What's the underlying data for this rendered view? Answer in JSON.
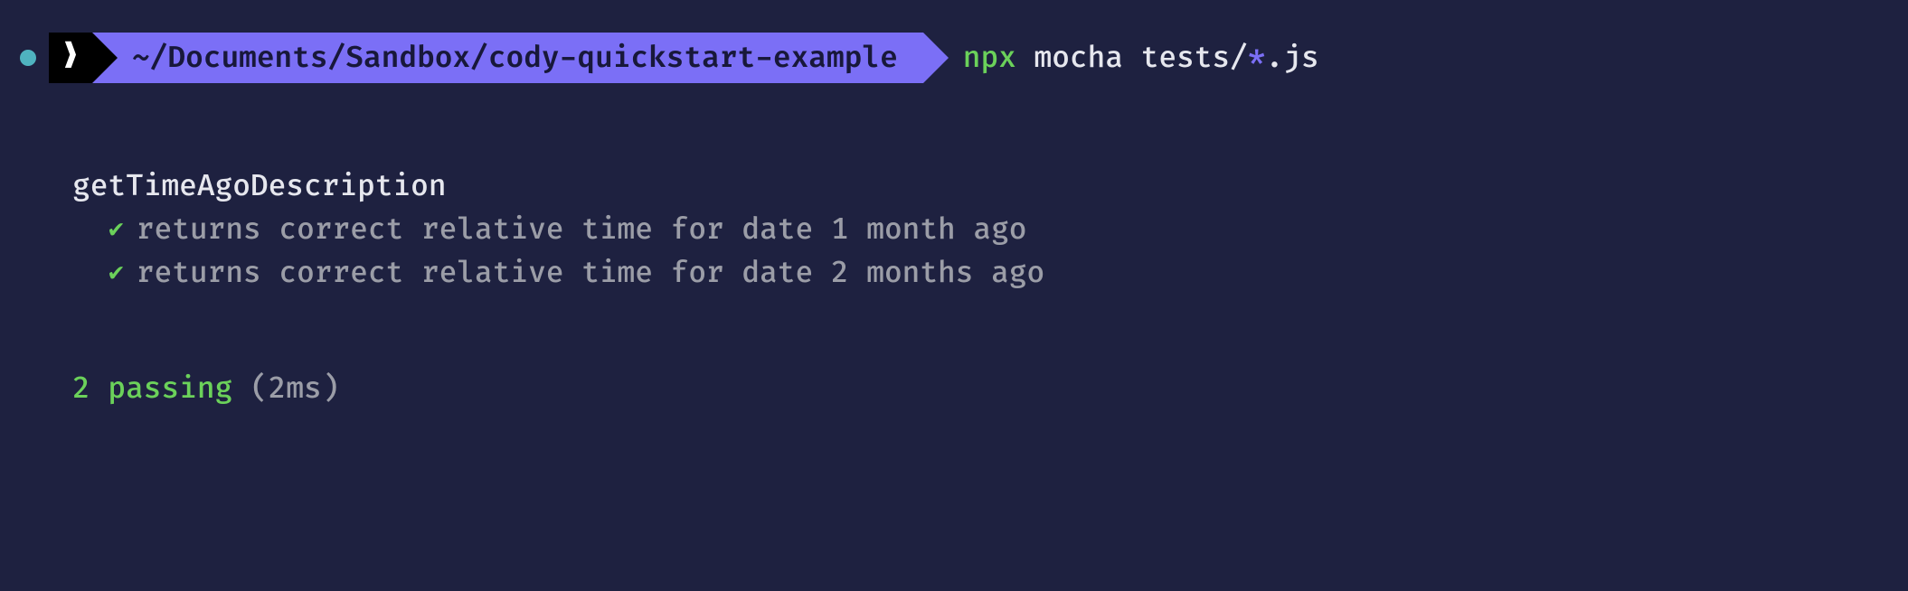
{
  "colors": {
    "bg": "#1e2140",
    "fg": "#e6e7ee",
    "dim": "#9b9da7",
    "green": "#6bd15a",
    "purple": "#7b6ff6"
  },
  "prompt": {
    "symbol": "❯",
    "cwd": "~/Documents/Sandbox/cody-quickstart-example",
    "command": {
      "bin": "npx",
      "args_pre": " mocha tests/",
      "glob": "*",
      "args_post": ".js"
    }
  },
  "test_output": {
    "suite": "getTimeAgoDescription",
    "tests": [
      {
        "status": "pass",
        "desc": "returns correct relative time for date 1 month ago"
      },
      {
        "status": "pass",
        "desc": "returns correct relative time for date 2 months ago"
      }
    ],
    "summary": {
      "passing_text": "2 passing",
      "duration_text": "(2ms)"
    }
  }
}
